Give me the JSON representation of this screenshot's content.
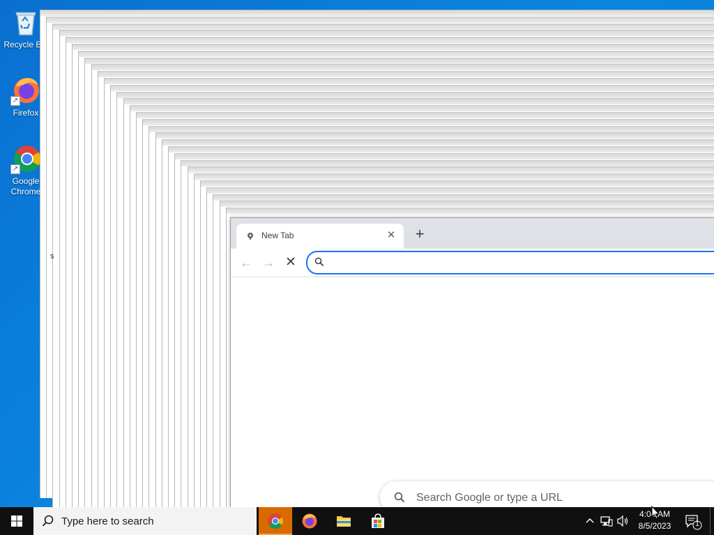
{
  "desktop": {
    "icons": [
      {
        "label": "Recycle Bin",
        "icon": "recycle-bin-icon"
      },
      {
        "label": "Firefox",
        "icon": "firefox-icon"
      },
      {
        "label": "Google Chrome",
        "icon": "chrome-icon"
      }
    ],
    "stray_text": "s"
  },
  "browser": {
    "tab": {
      "title": "New Tab",
      "favicon": "chrome-favicon-icon",
      "close_label": "✕"
    },
    "new_tab_label": "+",
    "nav": {
      "back": "←",
      "forward": "→",
      "stop": "✕"
    },
    "omnibox": {
      "value": "",
      "placeholder": ""
    },
    "ntp_search_placeholder": "Search Google or type a URL"
  },
  "taskbar": {
    "search_placeholder": "Type here to search",
    "apps": [
      {
        "name": "Google Chrome",
        "icon": "chrome-icon",
        "active": true
      },
      {
        "name": "Firefox",
        "icon": "firefox-icon",
        "active": false
      },
      {
        "name": "File Explorer",
        "icon": "folder-icon",
        "active": false
      },
      {
        "name": "Microsoft Store",
        "icon": "store-icon",
        "active": false
      }
    ],
    "clock": {
      "time": "4:04 AM",
      "date": "8/5/2023"
    },
    "notification_count": "1"
  },
  "colors": {
    "desktop_bg": "#0a79d6",
    "accent": "#1a73e8",
    "taskbar_bg": "#101010",
    "active_app_bg": "#d96a00"
  }
}
